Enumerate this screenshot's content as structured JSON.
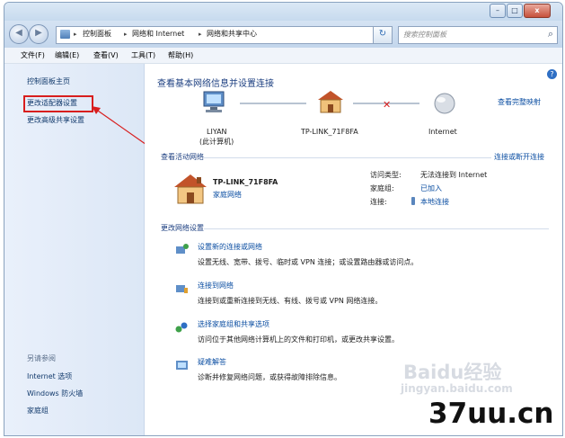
{
  "window": {
    "min_glyph": "–",
    "max_glyph": "□",
    "close_glyph": "x"
  },
  "address": {
    "breadcrumbs": [
      "控制面板",
      "网络和 Internet",
      "网络和共享中心"
    ],
    "separator": "▸",
    "search_placeholder": "搜索控制面板"
  },
  "menu": [
    "文件(F)",
    "编辑(E)",
    "查看(V)",
    "工具(T)",
    "帮助(H)"
  ],
  "sidebar": {
    "items": [
      "控制面板主页",
      "更改适配器设置",
      "更改高级共享设置"
    ],
    "see_also_title": "另请参阅",
    "see_also": [
      "Internet 选项",
      "Windows 防火墙",
      "家庭组"
    ]
  },
  "main": {
    "title": "查看基本网络信息并设置连接",
    "view_full_map": "查看完整映射",
    "map": {
      "computer_name": "LIYAN",
      "computer_sub": "(此计算机)",
      "router": "TP-LINK_71F8FA",
      "internet": "Internet",
      "broken_mark": "✕"
    },
    "active_title": "查看活动网络",
    "connect_disconnect": "连接或断开连接",
    "network": {
      "name": "TP-LINK_71F8FA",
      "type": "家庭网络",
      "access_type_label": "访问类型:",
      "access_type_value": "无法连接到 Internet",
      "homegroup_label": "家庭组:",
      "homegroup_value": "已加入",
      "connection_label": "连接:",
      "connection_value": "本地连接"
    },
    "change_title": "更改网络设置",
    "tasks": [
      {
        "title": "设置新的连接或网络",
        "desc": "设置无线、宽带、拨号、临时或 VPN 连接；或设置路由器或访问点。"
      },
      {
        "title": "连接到网络",
        "desc": "连接到或重新连接到无线、有线、拨号或 VPN 网络连接。"
      },
      {
        "title": "选择家庭组和共享选项",
        "desc": "访问位于其他网络计算机上的文件和打印机，或更改共享设置。"
      },
      {
        "title": "疑难解答",
        "desc": "诊断并修复网络问题，或获得故障排除信息。"
      }
    ]
  },
  "help_glyph": "?",
  "watermark": {
    "line1": "Baidu经验",
    "line2": "jingyan.baidu.com"
  },
  "brand": "37uu.cn",
  "colors": {
    "link": "#0b4ea2",
    "title": "#1c3f80",
    "highlight": "#d81e1e",
    "sidebar_bg": "#dce7f6"
  }
}
